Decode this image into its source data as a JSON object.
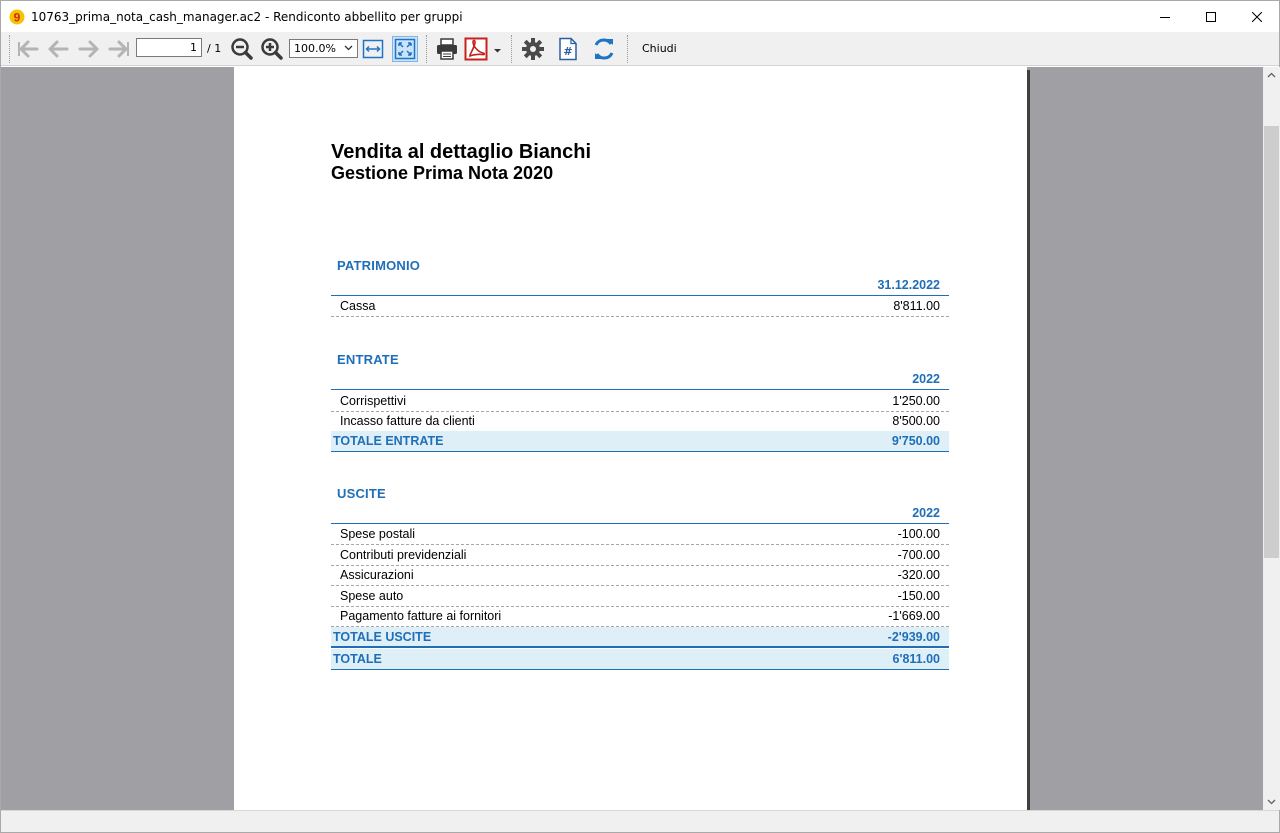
{
  "window": {
    "title": "10763_prima_nota_cash_manager.ac2 - Rendiconto abbellito per gruppi"
  },
  "toolbar": {
    "page_current": "1",
    "page_total": "/ 1",
    "zoom_value": "100.0%",
    "close_label": "Chiudi",
    "icons": [
      "first-page-icon",
      "previous-page-icon",
      "next-page-icon",
      "last-page-icon",
      "zoom-out-icon",
      "zoom-in-icon",
      "fit-width-icon",
      "fit-page-icon",
      "print-icon",
      "pdf-icon",
      "settings-icon",
      "page-number-icon",
      "refresh-icon"
    ]
  },
  "report": {
    "company": "Vendita al dettaglio Bianchi",
    "subtitle": "Gestione Prima Nota 2020",
    "patrimonio": {
      "title": "PATRIMONIO",
      "column": "31.12.2022",
      "rows": [
        {
          "label": "Cassa",
          "value": "8'811.00"
        }
      ]
    },
    "entrate": {
      "title": "ENTRATE",
      "column": "2022",
      "rows": [
        {
          "label": "Corrispettivi",
          "value": "1'250.00"
        },
        {
          "label": "Incasso fatture da clienti",
          "value": "8'500.00"
        }
      ],
      "total_label": "TOTALE ENTRATE",
      "total_value": "9'750.00"
    },
    "uscite": {
      "title": "USCITE",
      "column": "2022",
      "rows": [
        {
          "label": "Spese postali",
          "value": "-100.00"
        },
        {
          "label": "Contributi previdenziali",
          "value": "-700.00"
        },
        {
          "label": "Assicurazioni",
          "value": "-320.00"
        },
        {
          "label": "Spese auto",
          "value": "-150.00"
        },
        {
          "label": "Pagamento fatture ai fornitori",
          "value": "-1'669.00"
        }
      ],
      "total_label": "TOTALE USCITE",
      "total_value": "-2'939.00"
    },
    "grand_total_label": "TOTALE",
    "grand_total_value": "6'811.00"
  },
  "colors": {
    "accent": "#1f6fb8",
    "total_bg": "#deeff7",
    "viewer_bg": "#a0a0a4"
  }
}
